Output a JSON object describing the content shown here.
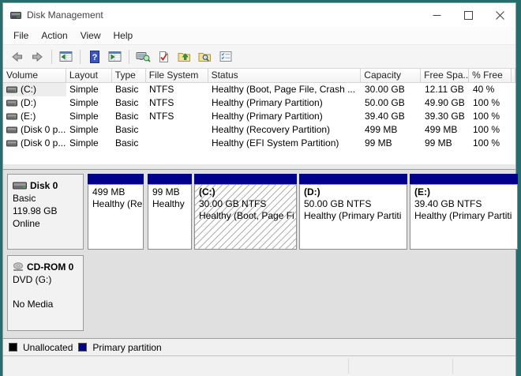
{
  "window": {
    "title": "Disk Management"
  },
  "menu": {
    "items": [
      "File",
      "Action",
      "View",
      "Help"
    ]
  },
  "toolbar": {
    "buttons": [
      "back",
      "forward",
      "show-hide-console-tree",
      "help",
      "show-hide-action-pane",
      "refresh-view",
      "rescan-disks",
      "open-folder-up",
      "find-folder",
      "properties-list"
    ]
  },
  "volume_list": {
    "columns": [
      "Volume",
      "Layout",
      "Type",
      "File System",
      "Status",
      "Capacity",
      "Free Spa...",
      "% Free"
    ],
    "rows": [
      {
        "volume": "(C:)",
        "layout": "Simple",
        "type": "Basic",
        "fs": "NTFS",
        "status": "Healthy (Boot, Page File, Crash ...",
        "capacity": "30.00 GB",
        "free": "12.11 GB",
        "pct": "40 %"
      },
      {
        "volume": "(D:)",
        "layout": "Simple",
        "type": "Basic",
        "fs": "NTFS",
        "status": "Healthy (Primary Partition)",
        "capacity": "50.00 GB",
        "free": "49.90 GB",
        "pct": "100 %"
      },
      {
        "volume": "(E:)",
        "layout": "Simple",
        "type": "Basic",
        "fs": "NTFS",
        "status": "Healthy (Primary Partition)",
        "capacity": "39.40 GB",
        "free": "39.30 GB",
        "pct": "100 %"
      },
      {
        "volume": "(Disk 0 p...",
        "layout": "Simple",
        "type": "Basic",
        "fs": "",
        "status": "Healthy (Recovery Partition)",
        "capacity": "499 MB",
        "free": "499 MB",
        "pct": "100 %"
      },
      {
        "volume": "(Disk 0 p...",
        "layout": "Simple",
        "type": "Basic",
        "fs": "",
        "status": "Healthy (EFI System Partition)",
        "capacity": "99 MB",
        "free": "99 MB",
        "pct": "100 %"
      }
    ]
  },
  "disk0": {
    "name": "Disk 0",
    "type": "Basic",
    "size": "119.98 GB",
    "state": "Online",
    "partitions": [
      {
        "label": "",
        "size": "499 MB",
        "status": "Healthy (Re"
      },
      {
        "label": "",
        "size": "99 MB",
        "status": "Healthy"
      },
      {
        "label": "(C:)",
        "size": "30.00 GB NTFS",
        "status": "Healthy (Boot, Page Fi"
      },
      {
        "label": "(D:)",
        "size": "50.00 GB NTFS",
        "status": "Healthy (Primary Partiti"
      },
      {
        "label": "(E:)",
        "size": "39.40 GB NTFS",
        "status": "Healthy (Primary Partiti"
      }
    ]
  },
  "cdrom": {
    "name": "CD-ROM 0",
    "drive": "DVD (G:)",
    "media": "No Media"
  },
  "legend": {
    "items": [
      {
        "label": "Unallocated",
        "color": "#000000"
      },
      {
        "label": "Primary partition",
        "color": "#00008B"
      }
    ]
  },
  "colors": {
    "partition_strip_navy": "#00008B",
    "desktop_teal": "#266e6e"
  }
}
